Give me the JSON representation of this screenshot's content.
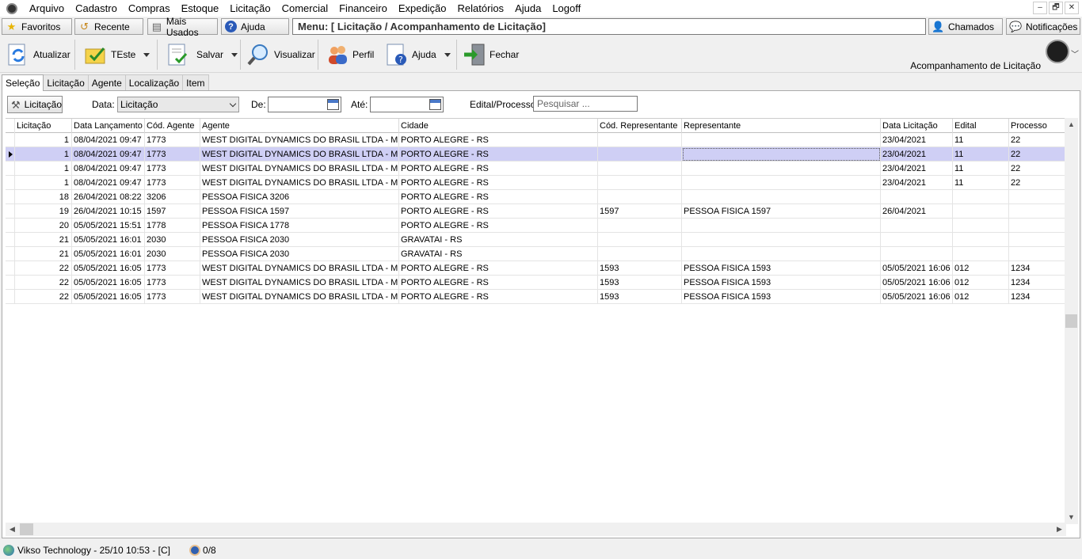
{
  "menubar": {
    "items": [
      "Arquivo",
      "Cadastro",
      "Compras",
      "Estoque",
      "Licitação",
      "Comercial",
      "Financeiro",
      "Expedição",
      "Relatórios",
      "Ajuda",
      "Logoff"
    ],
    "window_controls": [
      "–",
      "🗗",
      "✕"
    ]
  },
  "favbar": {
    "favoritos": "Favoritos",
    "recente": "Recente",
    "mais_usados": "Mais Usados",
    "ajuda": "Ajuda",
    "menu_path": "Menu: [ Licitação / Acompanhamento de Licitação]",
    "chamados": "Chamados",
    "notificacoes": "Notificações"
  },
  "toolbar": {
    "atualizar": "Atualizar",
    "teste": "TEste",
    "salvar": "Salvar",
    "visualizar": "Visualizar",
    "perfil": "Perfil",
    "ajuda": "Ajuda",
    "fechar": "Fechar",
    "screen_title": "Acompanhamento de Licitação"
  },
  "tabs": [
    "Seleção",
    "Licitação",
    "Agente",
    "Localização",
    "Item"
  ],
  "filters": {
    "licitacao_button": "Licitação",
    "data_label": "Data:",
    "data_value": "Licitação",
    "de_label": "De:",
    "ate_label": "Até:",
    "edital_label": "Edital/Processo:",
    "search_placeholder": "Pesquisar ..."
  },
  "grid": {
    "columns": [
      "Licitação",
      "Data Lançamento",
      "Cód. Agente",
      "Agente",
      "Cidade",
      "Cód. Representante",
      "Representante",
      "Data Licitação",
      "Edital",
      "Processo"
    ],
    "rows": [
      [
        "1",
        "08/04/2021 09:47",
        "1773",
        "WEST DIGITAL DYNAMICS DO BRASIL LTDA - ME",
        "PORTO ALEGRE - RS",
        "",
        "",
        "23/04/2021",
        "11",
        "22"
      ],
      [
        "1",
        "08/04/2021 09:47",
        "1773",
        "WEST DIGITAL DYNAMICS DO BRASIL LTDA - ME",
        "PORTO ALEGRE - RS",
        "",
        "",
        "23/04/2021",
        "11",
        "22"
      ],
      [
        "1",
        "08/04/2021 09:47",
        "1773",
        "WEST DIGITAL DYNAMICS DO BRASIL LTDA - ME",
        "PORTO ALEGRE - RS",
        "",
        "",
        "23/04/2021",
        "11",
        "22"
      ],
      [
        "1",
        "08/04/2021 09:47",
        "1773",
        "WEST DIGITAL DYNAMICS DO BRASIL LTDA - ME",
        "PORTO ALEGRE - RS",
        "",
        "",
        "23/04/2021",
        "11",
        "22"
      ],
      [
        "18",
        "26/04/2021 08:22",
        "3206",
        "PESSOA FISICA 3206",
        "PORTO ALEGRE - RS",
        "",
        "",
        "",
        "",
        ""
      ],
      [
        "19",
        "26/04/2021 10:15",
        "1597",
        "PESSOA FISICA 1597",
        "PORTO ALEGRE - RS",
        "1597",
        "PESSOA FISICA 1597",
        "26/04/2021",
        "",
        ""
      ],
      [
        "20",
        "05/05/2021 15:51",
        "1778",
        "PESSOA FISICA 1778",
        "PORTO ALEGRE - RS",
        "",
        "",
        "",
        "",
        ""
      ],
      [
        "21",
        "05/05/2021 16:01",
        "2030",
        "PESSOA FISICA 2030",
        "GRAVATAI - RS",
        "",
        "",
        "",
        "",
        ""
      ],
      [
        "21",
        "05/05/2021 16:01",
        "2030",
        "PESSOA FISICA 2030",
        "GRAVATAI - RS",
        "",
        "",
        "",
        "",
        ""
      ],
      [
        "22",
        "05/05/2021 16:05",
        "1773",
        "WEST DIGITAL DYNAMICS DO BRASIL LTDA - ME",
        "PORTO ALEGRE - RS",
        "1593",
        "PESSOA FISICA 1593",
        "05/05/2021 16:06",
        "012",
        "1234"
      ],
      [
        "22",
        "05/05/2021 16:05",
        "1773",
        "WEST DIGITAL DYNAMICS DO BRASIL LTDA - ME",
        "PORTO ALEGRE - RS",
        "1593",
        "PESSOA FISICA 1593",
        "05/05/2021 16:06",
        "012",
        "1234"
      ],
      [
        "22",
        "05/05/2021 16:05",
        "1773",
        "WEST DIGITAL DYNAMICS DO BRASIL LTDA - ME",
        "PORTO ALEGRE - RS",
        "1593",
        "PESSOA FISICA 1593",
        "05/05/2021 16:06",
        "012",
        "1234"
      ]
    ],
    "selected_row": 1
  },
  "statusbar": {
    "company": "Vikso Technology - 25/10 10:53 - [C]",
    "users": "0/8"
  },
  "colors": {
    "selected_row": "#cfcff5",
    "menu_path_text": "#333333"
  }
}
